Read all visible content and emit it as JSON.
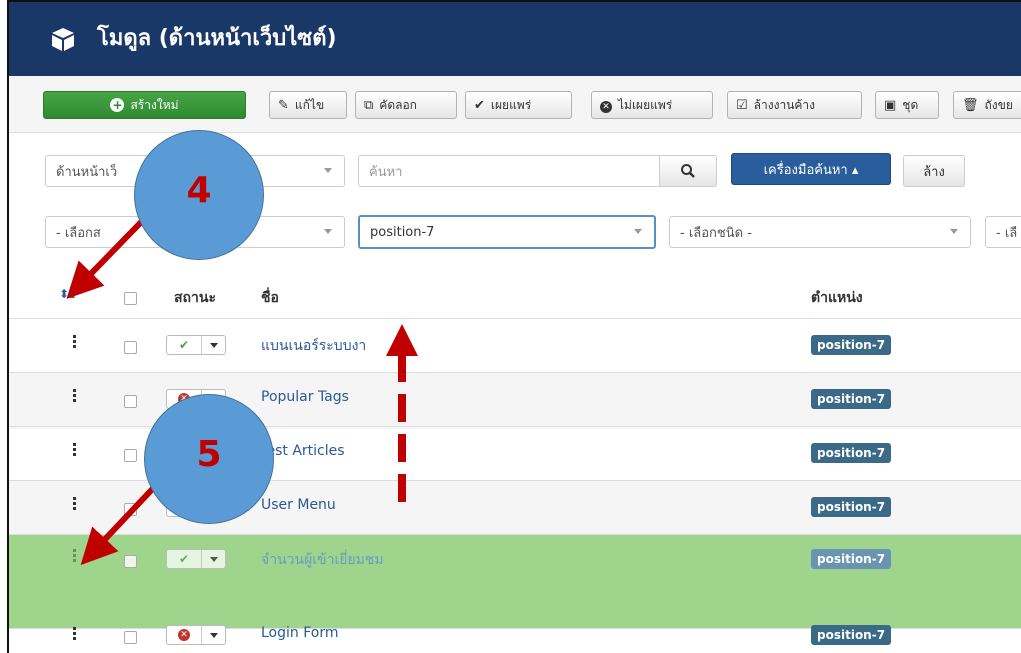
{
  "header": {
    "title": "โมดูล (ด้านหน้าเว็บไซต์)"
  },
  "toolbar": {
    "new": "สร้างใหม่",
    "edit": "แก้ไข",
    "duplicate": "คัดลอก",
    "publish": "เผยแพร่",
    "unpublish": "ไม่เผยแพร่",
    "checkin": "ล้างงานค้าง",
    "batch": "ชุด",
    "trash": "ถังขย"
  },
  "filters": {
    "client_select": "ด้านหน้าเว็",
    "search_placeholder": "ค้นหา",
    "search_tools": "เครื่องมือค้นหา ▴",
    "clear": "ล้าง",
    "status_select": "- เลือกส",
    "position_select": "position-7",
    "type_select": "- เลือกชนิด -",
    "extra_select": "- เลื"
  },
  "table": {
    "headers": {
      "status": "สถานะ",
      "name": "ชื่อ",
      "position": "ตำแหน่ง"
    },
    "rows": [
      {
        "name": "แบนเนอร์ระบบงา",
        "position": "position-7",
        "published": true
      },
      {
        "name": "Popular Tags",
        "position": "position-7",
        "published": false
      },
      {
        "name": "test Articles",
        "position": "position-7",
        "published": true
      },
      {
        "name": "User Menu",
        "position": "position-7",
        "published": true
      },
      {
        "name": "จำนวนผู้เข้าเยี่ยมชม",
        "position": "position-7",
        "published": true
      },
      {
        "name": "Login Form",
        "position": "position-7",
        "published": false
      }
    ]
  },
  "annotations": {
    "step4": "4",
    "step5": "5"
  },
  "colors": {
    "header": "#1a3867",
    "arrow": "#c00000",
    "circle": "#5b9bd5",
    "drag_row": "#9ed48c"
  }
}
